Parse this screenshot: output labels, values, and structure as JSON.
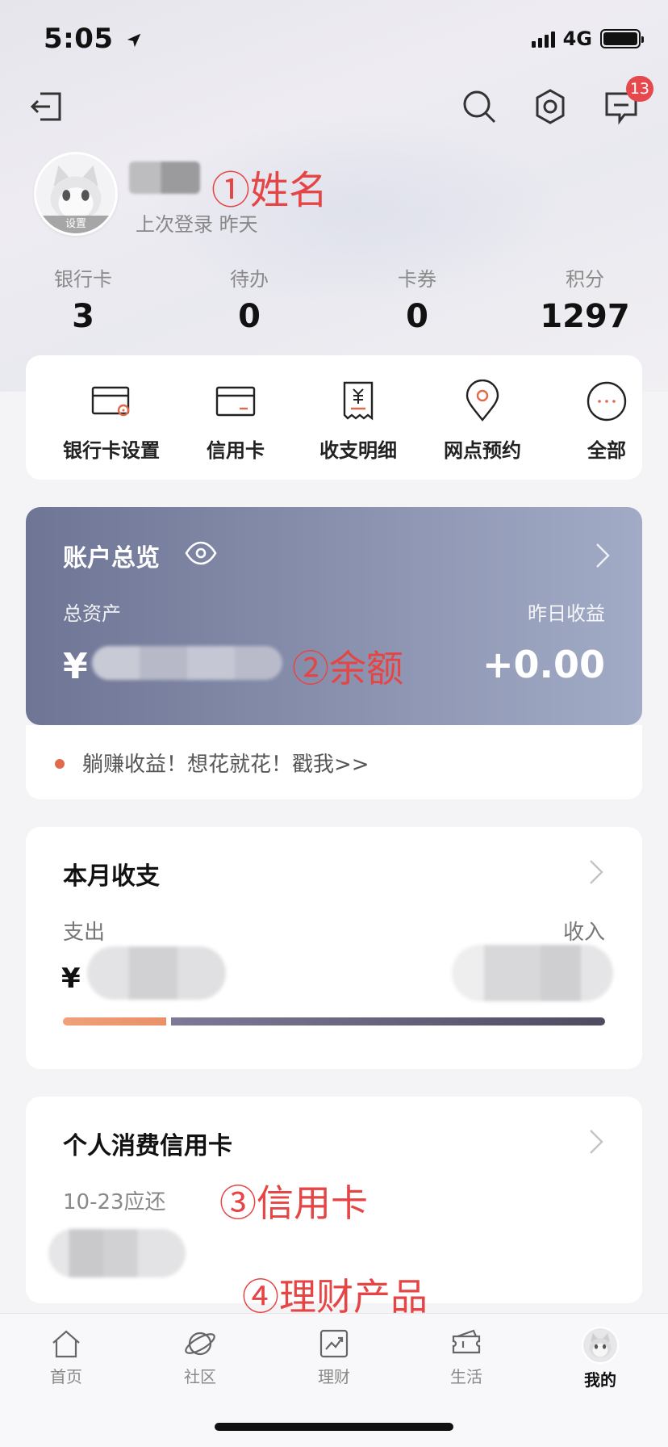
{
  "status_bar": {
    "time": "5:05",
    "network": "4G"
  },
  "header": {
    "message_badge": "13"
  },
  "profile": {
    "avatar_tag": "设置",
    "name_annotation": "①姓名",
    "last_login": "上次登录 昨天"
  },
  "stats": [
    {
      "label": "银行卡",
      "value": "3"
    },
    {
      "label": "待办",
      "value": "0"
    },
    {
      "label": "卡券",
      "value": "0"
    },
    {
      "label": "积分",
      "value": "1297"
    }
  ],
  "quick_actions": [
    {
      "label": "银行卡设置",
      "icon": "bank-card-settings-icon"
    },
    {
      "label": "信用卡",
      "icon": "credit-card-icon"
    },
    {
      "label": "收支明细",
      "icon": "receipt-icon"
    },
    {
      "label": "网点预约",
      "icon": "location-pin-icon"
    },
    {
      "label": "全部",
      "icon": "more-icon"
    }
  ],
  "account": {
    "title": "账户总览",
    "total_label": "总资产",
    "yesterday_label": "昨日收益",
    "currency": "¥",
    "balance_annotation": "②余额",
    "yesterday_value": "+0.00"
  },
  "promo": {
    "text": "躺赚收益！想花就花！戳我>>"
  },
  "monthly": {
    "title": "本月收支",
    "expense_label": "支出",
    "income_label": "收入",
    "currency": "¥",
    "expense_fraction": 0.19
  },
  "credit": {
    "title": "个人消费信用卡",
    "due": "10-23应还",
    "annotation": "③信用卡"
  },
  "finance_annotation": "④理财产品",
  "tabs": [
    {
      "label": "首页",
      "icon": "home-icon"
    },
    {
      "label": "社区",
      "icon": "planet-icon"
    },
    {
      "label": "理财",
      "icon": "chart-icon"
    },
    {
      "label": "生活",
      "icon": "ticket-icon"
    },
    {
      "label": "我的",
      "icon": "avatar-icon",
      "active": true
    }
  ],
  "colors": {
    "annotation": "#e64545",
    "account_card_start": "#6f7595",
    "account_card_end": "#a2abc6",
    "badge": "#e5484d",
    "expense_bar": "#e99068",
    "income_bar": "#4f4b61"
  }
}
